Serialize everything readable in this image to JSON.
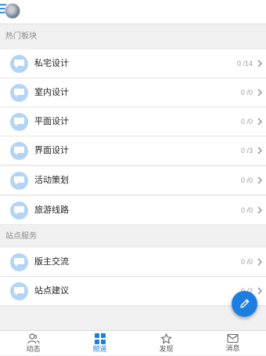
{
  "sections": [
    {
      "title": "热门板块",
      "items": [
        {
          "label": "私宅设计",
          "count": "0 /14"
        },
        {
          "label": "室内设计",
          "count": "0 /0"
        },
        {
          "label": "平面设计",
          "count": "0 /0"
        },
        {
          "label": "界面设计",
          "count": "0 /3"
        },
        {
          "label": "活动策划",
          "count": "0 /0"
        },
        {
          "label": "旅游线路",
          "count": "0 /0"
        }
      ]
    },
    {
      "title": "站点服务",
      "items": [
        {
          "label": "版主交流",
          "count": "0 /0"
        },
        {
          "label": "站点建议",
          "count": "0 /2"
        }
      ]
    }
  ],
  "tabbar": {
    "tabs": [
      {
        "label": "动态",
        "icon": "people-icon"
      },
      {
        "label": "频道",
        "icon": "grid-icon"
      },
      {
        "label": "发现",
        "icon": "star-icon"
      },
      {
        "label": "消息",
        "icon": "mail-icon"
      }
    ],
    "active": "频道"
  },
  "fab": {
    "icon": "pencil-icon"
  },
  "colors": {
    "accent": "#1a7fe0",
    "forum_icon_bg": "#b3d4f4",
    "background": "#f0f0f0"
  }
}
